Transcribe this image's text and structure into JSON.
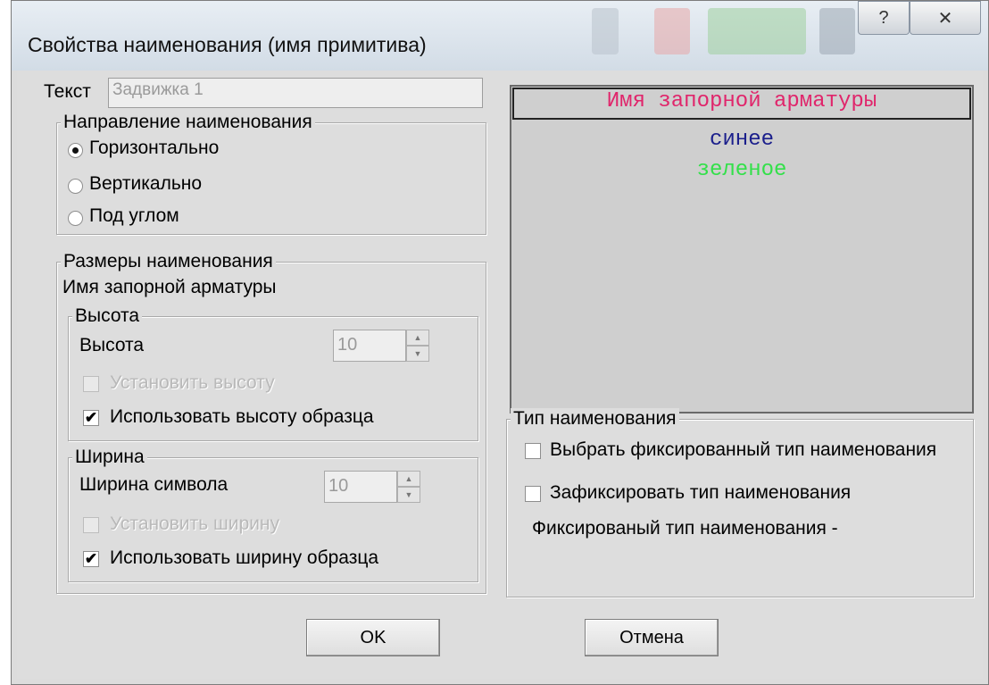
{
  "window": {
    "title": "Свойства наименования (имя примитива)",
    "help_glyph": "?",
    "close_glyph": "✕"
  },
  "text_field": {
    "label": "Текст",
    "value": "Задвижка 1"
  },
  "direction": {
    "legend": "Направление наименования",
    "options": [
      {
        "label": "Горизонтально",
        "selected": true
      },
      {
        "label": "Вертикально",
        "selected": false
      },
      {
        "label": "Под углом",
        "selected": false
      }
    ]
  },
  "sizes": {
    "legend": "Размеры наименования",
    "subtitle": "Имя запорной арматуры",
    "height": {
      "legend": "Высота",
      "label": "Высота",
      "value": "10",
      "set_label": "Установить высоту",
      "use_sample_label": "Использовать высоту образца",
      "use_sample_checked": true
    },
    "width": {
      "legend": "Ширина",
      "label": "Ширина символа",
      "value": "10",
      "set_label": "Установить ширину",
      "use_sample_label": "Использовать ширину образца",
      "use_sample_checked": true
    }
  },
  "preview": {
    "lines": [
      {
        "text": "Имя запорной арматуры",
        "color": "#e0256b"
      },
      {
        "text": "синее",
        "color": "#1b1f8c"
      },
      {
        "text": "зеленое",
        "color": "#33e04a"
      }
    ]
  },
  "name_type": {
    "legend": "Тип наименования",
    "fixed_type_label": "Выбрать фиксированный тип наименования",
    "fix_type_label": "Зафиксировать тип наименования",
    "fixed_type_info": "Фиксированый тип наименования -"
  },
  "buttons": {
    "ok": "OK",
    "cancel": "Отмена"
  },
  "colors": {
    "dialog_bg": "#dddddd",
    "title_bg": "#dbe4ee"
  }
}
